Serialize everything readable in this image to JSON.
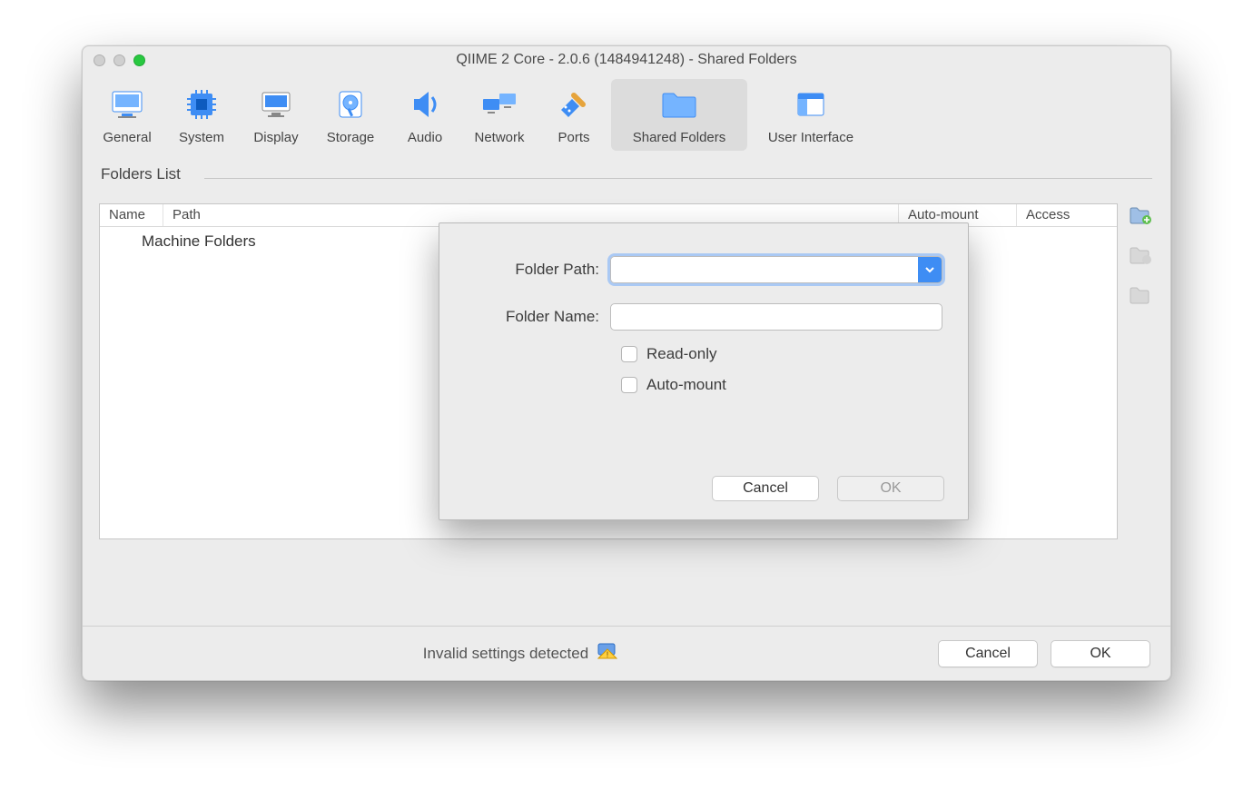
{
  "window": {
    "title": "QIIME 2 Core - 2.0.6 (1484941248) - Shared Folders"
  },
  "toolbar": {
    "items": [
      {
        "label": "General"
      },
      {
        "label": "System"
      },
      {
        "label": "Display"
      },
      {
        "label": "Storage"
      },
      {
        "label": "Audio"
      },
      {
        "label": "Network"
      },
      {
        "label": "Ports"
      },
      {
        "label": "Shared Folders"
      },
      {
        "label": "User Interface"
      }
    ]
  },
  "section": {
    "title": "Folders List"
  },
  "table": {
    "columns": {
      "name": "Name",
      "path": "Path",
      "auto": "Auto-mount",
      "access": "Access"
    },
    "group": "Machine Folders"
  },
  "sheet": {
    "folder_path_label": "Folder Path:",
    "folder_name_label": "Folder Name:",
    "folder_path_value": "",
    "folder_name_value": "",
    "read_only_label": "Read-only",
    "auto_mount_label": "Auto-mount",
    "cancel": "Cancel",
    "ok": "OK"
  },
  "status": {
    "text": "Invalid settings detected"
  },
  "buttons": {
    "cancel": "Cancel",
    "ok": "OK"
  }
}
